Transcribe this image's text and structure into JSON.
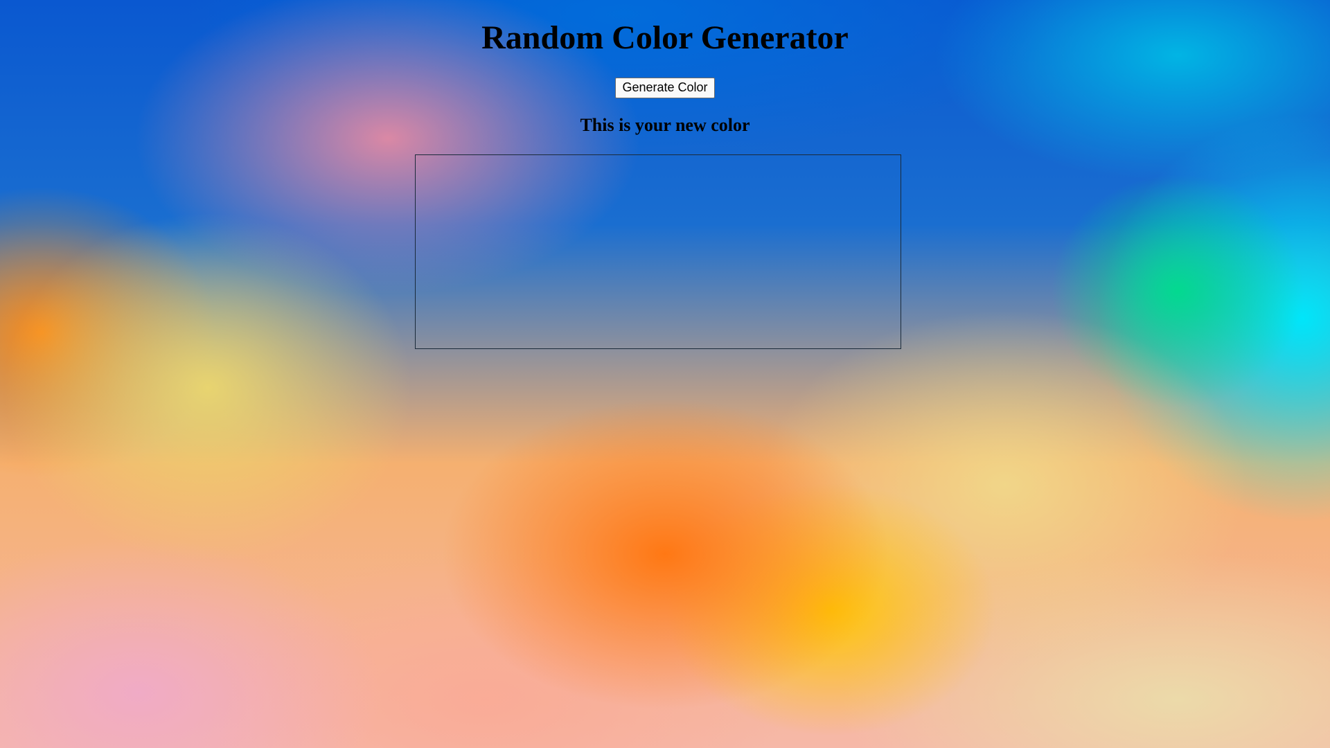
{
  "page": {
    "title": "Random Color Generator",
    "button_label": "Generate Color",
    "subtitle": "This is your new color"
  },
  "color_box": {
    "fill": "transparent",
    "border_color": "#1a2a3a"
  }
}
